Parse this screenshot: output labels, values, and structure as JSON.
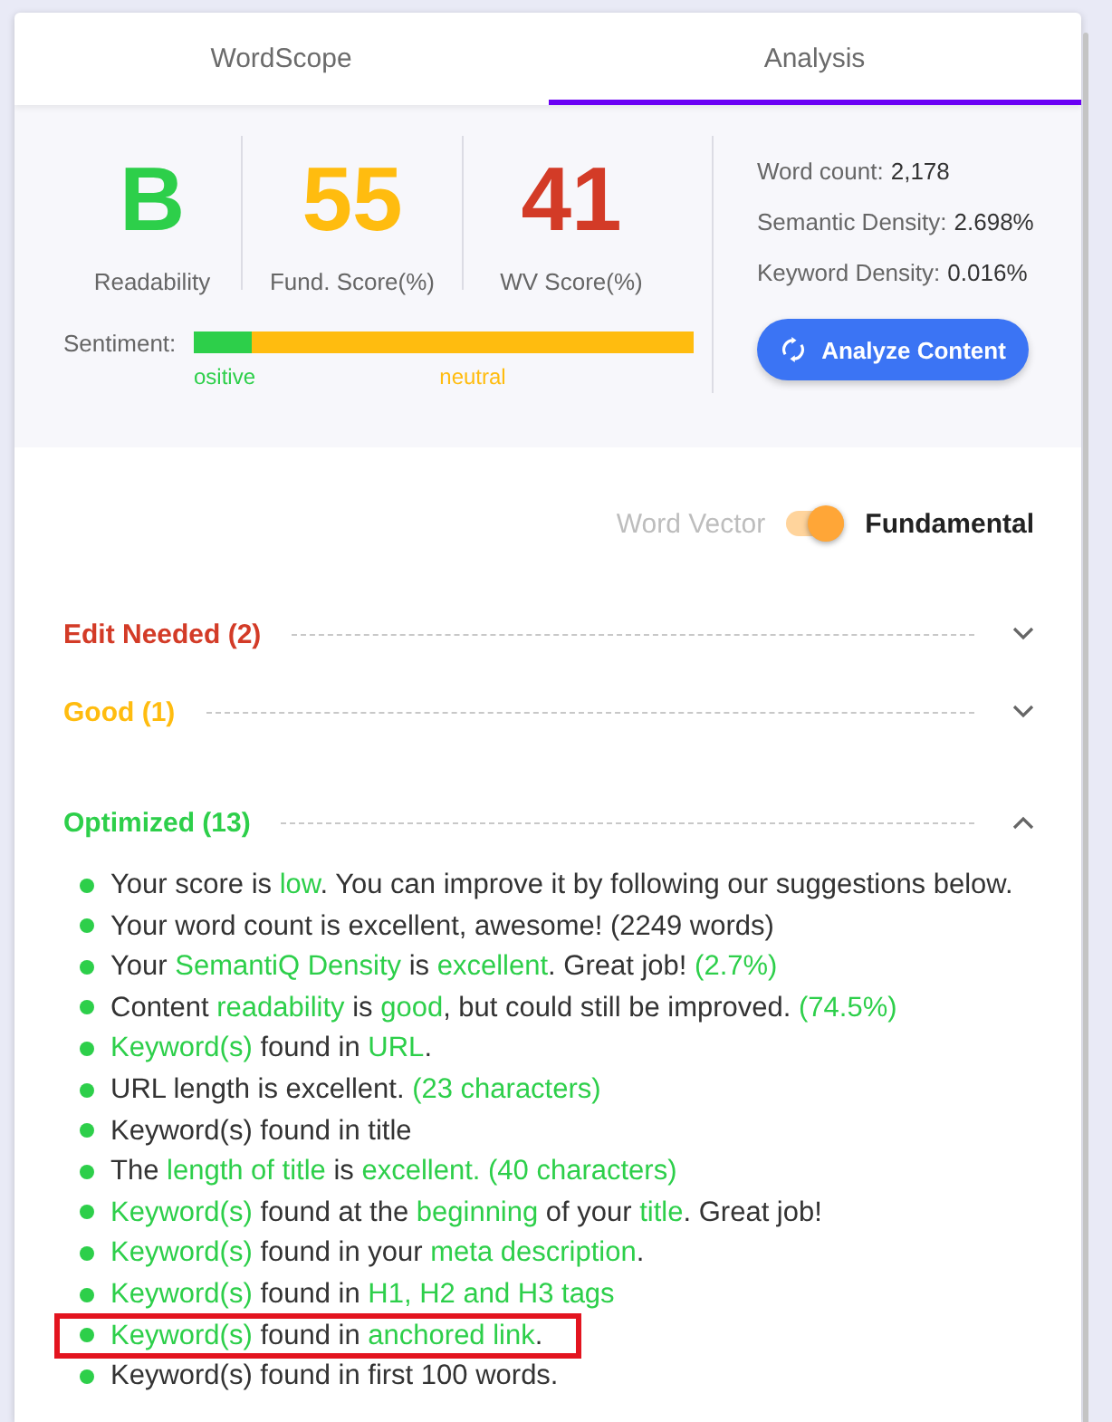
{
  "tabs": [
    {
      "label": "WordScope",
      "selected": false
    },
    {
      "label": "Analysis",
      "selected": true
    }
  ],
  "scores": [
    {
      "value": "B",
      "label": "Readability",
      "color": "#2dcf4a"
    },
    {
      "value": "55",
      "label": "Fund. Score(%)",
      "color": "#ffbc0f"
    },
    {
      "value": "41",
      "label": "WV Score(%)",
      "color": "#d33b27"
    }
  ],
  "sentiment": {
    "label": "Sentiment:",
    "level": 0.116,
    "positive_label": "ositive",
    "neutral_label": "neutral"
  },
  "metrics": [
    {
      "label": "Word count:",
      "value": "2,178"
    },
    {
      "label": "Semantic Density:",
      "value": "2.698%"
    },
    {
      "label": "Keyword Density:",
      "value": "0.016%"
    }
  ],
  "analyze_button": {
    "label": "Analyze Content"
  },
  "toggle": {
    "left_label": "Word Vector",
    "right_label": "Fundamental",
    "on": true
  },
  "sections": [
    {
      "title": "Edit Needed (2)",
      "color": "#d33b27",
      "expanded": false
    },
    {
      "title": "Good (1)",
      "color": "#ffbc0f",
      "expanded": false
    },
    {
      "title": "Optimized (13)",
      "color": "#2dcf4a",
      "expanded": true,
      "items": [
        {
          "outlined": false,
          "parts": [
            {
              "text": "Your score is ",
              "accent": false
            },
            {
              "text": "low",
              "accent": true
            },
            {
              "text": ". You can improve it by following our suggestions below.",
              "accent": false
            }
          ]
        },
        {
          "outlined": false,
          "parts": [
            {
              "text": "Your word count is excellent, awesome! (2249 words)",
              "accent": false
            }
          ]
        },
        {
          "outlined": false,
          "parts": [
            {
              "text": "Your ",
              "accent": false
            },
            {
              "text": "SemantiQ Density",
              "accent": true
            },
            {
              "text": " is ",
              "accent": false
            },
            {
              "text": "excellent",
              "accent": true
            },
            {
              "text": ". Great job! ",
              "accent": false
            },
            {
              "text": "(2.7%)",
              "accent": true
            }
          ]
        },
        {
          "outlined": false,
          "parts": [
            {
              "text": "Content ",
              "accent": false
            },
            {
              "text": "readability",
              "accent": true
            },
            {
              "text": " is ",
              "accent": false
            },
            {
              "text": "good",
              "accent": true
            },
            {
              "text": ", but could still be improved. ",
              "accent": false
            },
            {
              "text": "(74.5%)",
              "accent": true
            }
          ]
        },
        {
          "outlined": false,
          "parts": [
            {
              "text": "Keyword(s)",
              "accent": true
            },
            {
              "text": " found in ",
              "accent": false
            },
            {
              "text": "URL",
              "accent": true
            },
            {
              "text": ".",
              "accent": false
            }
          ]
        },
        {
          "outlined": false,
          "parts": [
            {
              "text": "URL length is excellent. ",
              "accent": false
            },
            {
              "text": "(23 characters)",
              "accent": true
            }
          ]
        },
        {
          "outlined": false,
          "parts": [
            {
              "text": "Keyword(s) found in title",
              "accent": false
            }
          ]
        },
        {
          "outlined": false,
          "parts": [
            {
              "text": "The ",
              "accent": false
            },
            {
              "text": "length of title",
              "accent": true
            },
            {
              "text": " is ",
              "accent": false
            },
            {
              "text": "excellent. (40 characters)",
              "accent": true
            }
          ]
        },
        {
          "outlined": false,
          "parts": [
            {
              "text": "Keyword(s)",
              "accent": true
            },
            {
              "text": " found at the ",
              "accent": false
            },
            {
              "text": "beginning",
              "accent": true
            },
            {
              "text": " of your ",
              "accent": false
            },
            {
              "text": "title",
              "accent": true
            },
            {
              "text": ". Great job!",
              "accent": false
            }
          ]
        },
        {
          "outlined": false,
          "parts": [
            {
              "text": "Keyword(s)",
              "accent": true
            },
            {
              "text": " found in your ",
              "accent": false
            },
            {
              "text": "meta description",
              "accent": true
            },
            {
              "text": ".",
              "accent": false
            }
          ]
        },
        {
          "outlined": false,
          "parts": [
            {
              "text": "Keyword(s)",
              "accent": true
            },
            {
              "text": " found in ",
              "accent": false
            },
            {
              "text": "H1, H2 and H3 tags",
              "accent": true
            }
          ]
        },
        {
          "outlined": true,
          "parts": [
            {
              "text": "Keyword(s)",
              "accent": true
            },
            {
              "text": " found in ",
              "accent": false
            },
            {
              "text": "anchored link",
              "accent": true
            },
            {
              "text": ".",
              "accent": false
            }
          ]
        },
        {
          "outlined": false,
          "parts": [
            {
              "text": "Keyword(s) found in first 100 words.",
              "accent": false
            }
          ]
        }
      ]
    }
  ]
}
